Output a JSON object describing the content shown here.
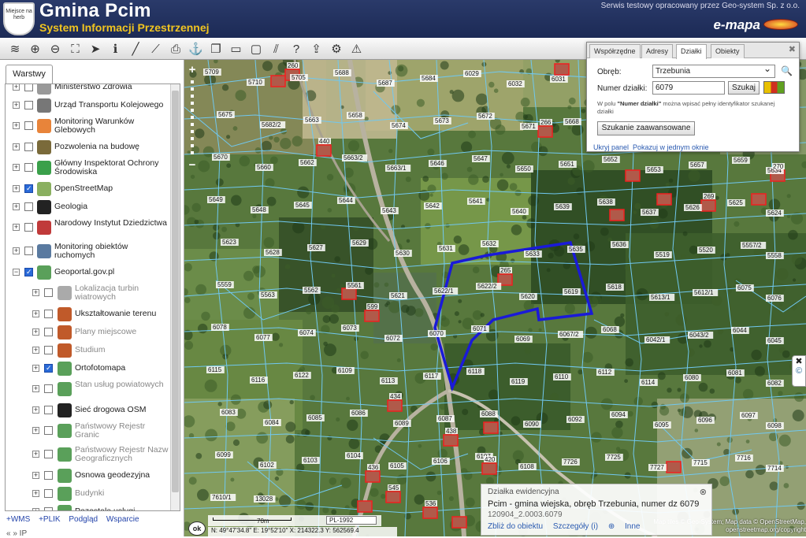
{
  "header": {
    "crest_text": "Miejsce na herb",
    "title": "Gmina Pcim",
    "subtitle": "System Informacji Przestrzennej",
    "service_note": "Serwis testowy opracowany przez Geo-system Sp. z o.o.",
    "brand": "e-mapa"
  },
  "toolbar": {
    "tools": [
      "layers-icon",
      "zoom-in-icon",
      "zoom-out-icon",
      "zoom-extent-icon",
      "pointer-icon",
      "info-icon",
      "measure-line-icon",
      "measure-area-icon",
      "print-icon",
      "marker-icon",
      "copy-icon",
      "draw-rectangle-icon",
      "speech-bubble-icon",
      "hatch-icon",
      "help-icon",
      "upload-icon",
      "settings-icon",
      "warning-icon"
    ]
  },
  "sidebar": {
    "tab_label": "Warstwy",
    "layers": [
      {
        "name": "Ministerstwo Zdrowia",
        "level": "top",
        "checked": false,
        "muted": false,
        "icon_color": "#999"
      },
      {
        "name": "Urząd Transportu Kolejowego",
        "level": "top",
        "checked": false,
        "muted": false,
        "icon_color": "#777"
      },
      {
        "name": "Monitoring Warunków Glebowych",
        "level": "top",
        "checked": false,
        "muted": false,
        "icon_color": "#e8843a"
      },
      {
        "name": "Pozwolenia na budowę",
        "level": "top",
        "checked": false,
        "muted": false,
        "icon_color": "#7a6a3a"
      },
      {
        "name": "Główny Inspektorat Ochrony Środowiska",
        "level": "top",
        "checked": false,
        "muted": false,
        "icon_color": "#3aa04a"
      },
      {
        "name": "OpenStreetMap",
        "level": "top",
        "checked": true,
        "muted": false,
        "icon_color": "#8ab060"
      },
      {
        "name": "Geologia",
        "level": "top",
        "checked": false,
        "muted": false,
        "icon_color": "#222"
      },
      {
        "name": "Narodowy Instytut Dziedzictwa",
        "level": "top",
        "checked": false,
        "muted": false,
        "icon_color": "#c03a3a"
      },
      {
        "name": "Monitoring obiektów ruchomych",
        "level": "top",
        "checked": false,
        "muted": false,
        "icon_color": "#5a7aa0"
      },
      {
        "name": "Geoportal.gov.pl",
        "level": "top",
        "checked": true,
        "muted": false,
        "icon_color": "#5aa05a"
      },
      {
        "name": "Lokalizacja turbin wiatrowych",
        "level": "sub",
        "checked": false,
        "muted": true,
        "icon_color": "#aaa"
      },
      {
        "name": "Ukształtowanie terenu",
        "level": "sub",
        "checked": false,
        "muted": false,
        "icon_color": "#c05a2a"
      },
      {
        "name": "Plany miejscowe",
        "level": "sub",
        "checked": false,
        "muted": true,
        "icon_color": "#c05a2a"
      },
      {
        "name": "Studium",
        "level": "sub",
        "checked": false,
        "muted": true,
        "icon_color": "#c05a2a"
      },
      {
        "name": "Ortofotomapa",
        "level": "sub",
        "checked": true,
        "muted": false,
        "icon_color": "#5aa05a"
      },
      {
        "name": "Stan usług powiatowych",
        "level": "sub",
        "checked": false,
        "muted": true,
        "icon_color": "#5aa05a"
      },
      {
        "name": "Sieć drogowa OSM",
        "level": "sub",
        "checked": false,
        "muted": false,
        "icon_color": "#222"
      },
      {
        "name": "Państwowy Rejestr Granic",
        "level": "sub",
        "checked": false,
        "muted": true,
        "icon_color": "#5aa05a"
      },
      {
        "name": "Państwowy Rejestr Nazw Geograficznych",
        "level": "sub",
        "checked": false,
        "muted": true,
        "icon_color": "#5aa05a"
      },
      {
        "name": "Osnowa geodezyjna",
        "level": "sub",
        "checked": false,
        "muted": false,
        "icon_color": "#5aa05a"
      },
      {
        "name": "Budynki",
        "level": "sub",
        "checked": false,
        "muted": true,
        "icon_color": "#5aa05a"
      },
      {
        "name": "Pozostałe usługi",
        "level": "sub",
        "checked": false,
        "muted": false,
        "icon_color": "#5aa05a"
      }
    ],
    "links": [
      "+WMS",
      "+PLIK",
      "Podgląd",
      "Wsparcie"
    ],
    "nav": "«  »  IP"
  },
  "map": {
    "zoom_in": "+",
    "zoom_out": "−",
    "ok_label": "ok",
    "scale_label": "70m",
    "crs": "PL-1992",
    "coords": "N: 49°47'34.8\"   E: 19°52'10\"     X: 214322.3    Y: 562569.4",
    "attribution": "Map tiles © Geo-System; Map data © OpenStreetMap, openstreetmap.org/copyright",
    "parcel_labels": [
      "5709",
      "5710",
      "5705",
      "5688",
      "5687",
      "5684",
      "6029",
      "6032",
      "6031",
      "5680",
      "5682/1",
      "5683",
      "5681",
      "5678",
      "5675",
      "5682/2",
      "5663",
      "5658",
      "5674",
      "5673",
      "5672",
      "5671",
      "5668",
      "5667",
      "5666",
      "5669",
      "5664",
      "5665",
      "5670",
      "5660",
      "5662",
      "5663/2",
      "5663/1",
      "5646",
      "5647",
      "5650",
      "5651",
      "5652",
      "5653",
      "5657",
      "5659",
      "5634",
      "5649",
      "5648",
      "5645",
      "5644",
      "5643",
      "5642",
      "5641",
      "5640",
      "5639",
      "5638",
      "5637",
      "5626",
      "5625",
      "5624",
      "5623",
      "5628",
      "5627",
      "5629",
      "5630",
      "5631",
      "5632",
      "5633",
      "5635",
      "5636",
      "5519",
      "5520",
      "5557/2",
      "5558",
      "5559",
      "5563",
      "5562",
      "5561",
      "5621",
      "5622/1",
      "5622/2",
      "5620",
      "5619",
      "5618",
      "5613/1",
      "5612/1",
      "6075",
      "6076",
      "6078",
      "6077",
      "6074",
      "6073",
      "6072",
      "6070",
      "6071",
      "6069",
      "6067/2",
      "6068",
      "6042/1",
      "6043/2",
      "6044",
      "6045",
      "6115",
      "6116",
      "6122",
      "6109",
      "6113",
      "6117",
      "6118",
      "6119",
      "6110",
      "6112",
      "6114",
      "6080",
      "6081",
      "6082",
      "6083",
      "6084",
      "6085",
      "6086",
      "6089",
      "6087",
      "6088",
      "6090",
      "6092",
      "6094",
      "6095",
      "6096",
      "6097",
      "6098",
      "6099",
      "6102",
      "6103",
      "6104",
      "6105",
      "6106",
      "6107",
      "6108",
      "7726",
      "7725",
      "7727",
      "7715",
      "7716",
      "7714",
      "7610/1",
      "13028"
    ],
    "building_labels": [
      "260",
      "440",
      "265",
      "599",
      "434",
      "438",
      "420",
      "436",
      "545",
      "536",
      "266",
      "269",
      "270"
    ],
    "highlighted_parcel": "6079"
  },
  "popup": {
    "heading": "Działka ewidencyjna",
    "main": "Pcim - gmina wiejska, obręb Trzebunia, numer dz 6079",
    "id": "120904_2.0003.6079",
    "link_zoom": "Zbliż do obiektu",
    "link_details": "Szczegóły (i)",
    "link_other": "Inne"
  },
  "search_panel": {
    "tabs": [
      "Współrzędne",
      "Adresy",
      "Działki",
      "Obiekty"
    ],
    "active_tab": "Działki",
    "obreb_label": "Obręb:",
    "obreb_value": "Trzebunia",
    "numer_label": "Numer działki:",
    "numer_value": "6079",
    "search_button": "Szukaj",
    "hint_prefix": "W polu",
    "hint_bold": "\"Numer działki\"",
    "hint_suffix": "można wpisać pełny identyfikator szukanej działki",
    "advanced_button": "Szukanie zaawansowane",
    "footer_hide": "Ukryj panel",
    "footer_window": "Pokazuj w jednym oknie"
  },
  "colors": {
    "header_bg": "#1c2a55",
    "subtitle": "#f0c420",
    "parcel_line": "#70c8f0",
    "highlight": "#1a1ad8",
    "link": "#2a5ab0"
  }
}
